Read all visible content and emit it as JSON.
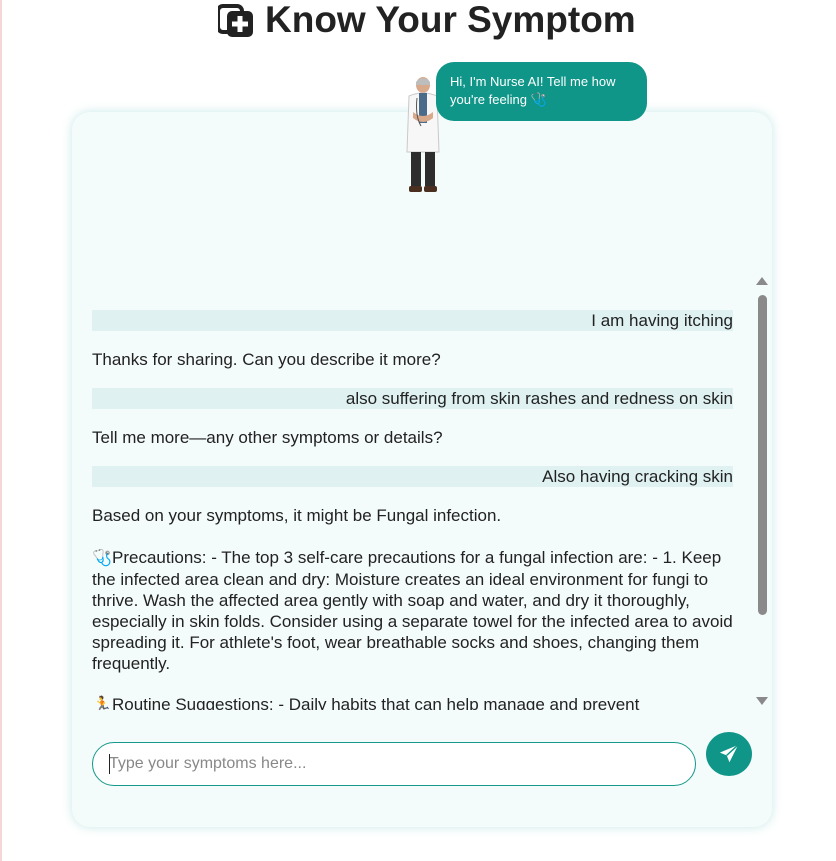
{
  "header": {
    "title": "Know Your Symptom",
    "icon": "medical-plus-copy-icon"
  },
  "nurse": {
    "bubble_text": "Hi, I'm Nurse AI! Tell me how you're feeling 🩺",
    "avatar": "doctor-figure"
  },
  "chat": {
    "messages": [
      {
        "role": "user",
        "text": "I am having itching"
      },
      {
        "role": "bot",
        "text": "Thanks for sharing. Can you describe it more?"
      },
      {
        "role": "user",
        "text": "also suffering from skin rashes and redness on skin"
      },
      {
        "role": "bot",
        "text": "Tell me more—any other symptoms or details?"
      },
      {
        "role": "user",
        "text": "Also having cracking skin"
      },
      {
        "role": "bot",
        "text": "Based on your symptoms, it might be Fungal infection."
      },
      {
        "role": "bot",
        "emoji": "🩺",
        "text": "Precautions: - The top 3 self-care precautions for a fungal infection are: - 1. Keep the infected area clean and dry: Moisture creates an ideal environment for fungi to thrive. Wash the affected area gently with soap and water, and dry it thoroughly, especially in skin folds. Consider using a separate towel for the infected area to avoid spreading it. For athlete's foot, wear breathable socks and shoes, changing them frequently."
      },
      {
        "role": "bot",
        "emoji": "🏃",
        "text": "Routine Suggestions: - Daily habits that can help manage and prevent"
      }
    ]
  },
  "input": {
    "placeholder": "Type your symptoms here...",
    "value": ""
  },
  "send_button": {
    "icon": "paper-plane-icon"
  },
  "colors": {
    "accent": "#0f9688",
    "card_bg": "#f4fbfb",
    "user_msg_bg": "#dff1f1",
    "scrollbar": "#8a8a8a"
  }
}
